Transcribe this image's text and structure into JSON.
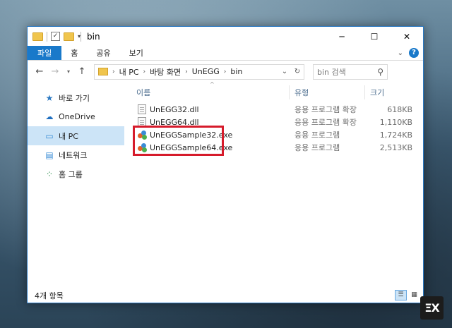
{
  "window": {
    "title": "bin"
  },
  "ribbon": {
    "tabs": [
      "파일",
      "홈",
      "공유",
      "보기"
    ]
  },
  "address": {
    "crumbs": [
      "내 PC",
      "바탕 화면",
      "UnEGG",
      "bin"
    ],
    "search_placeholder": "bin 검색"
  },
  "sidebar": {
    "items": [
      {
        "label": "바로 가기",
        "icon": "star-icon"
      },
      {
        "label": "OneDrive",
        "icon": "cloud-icon"
      },
      {
        "label": "내 PC",
        "icon": "pc-icon",
        "selected": true
      },
      {
        "label": "네트워크",
        "icon": "network-icon"
      },
      {
        "label": "홈 그룹",
        "icon": "homegroup-icon"
      }
    ]
  },
  "columns": {
    "name": "이름",
    "type": "유형",
    "size": "크기"
  },
  "files": [
    {
      "name": "UnEGG32.dll",
      "type": "응용 프로그램 확장",
      "size": "618KB",
      "icon": "dll-icon"
    },
    {
      "name": "UnEGG64.dll",
      "type": "응용 프로그램 확장",
      "size": "1,110KB",
      "icon": "dll-icon"
    },
    {
      "name": "UnEGGSample32.exe",
      "type": "응용 프로그램",
      "size": "1,724KB",
      "icon": "exe-icon"
    },
    {
      "name": "UnEGGSample64.exe",
      "type": "응용 프로그램",
      "size": "2,513KB",
      "icon": "exe-icon"
    }
  ],
  "status": {
    "count": "4개 항목"
  },
  "colors": {
    "accent": "#1979ca",
    "highlight": "#d61b2b",
    "selected": "#cce4f7"
  }
}
